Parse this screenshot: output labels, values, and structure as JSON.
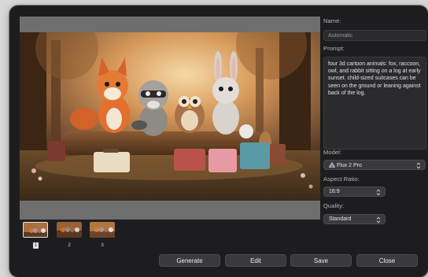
{
  "preview": {
    "alt_icon": "generated-image"
  },
  "fields": {
    "name_label": "Name:",
    "name_value": "Automatic",
    "prompt_label": "Prompt:",
    "prompt_value": "four 3d cartoon animals: fox, raccoon, owl, and rabbit sitting on a log at early sunset. child-sized suitcases can be seen on the ground or leaning against back of the log.",
    "model_label": "Model:",
    "model_value": "Flux 2 Pro",
    "model_icon": "flux-icon",
    "aspect_label": "Aspect Ratio:",
    "aspect_value": "16:9",
    "quality_label": "Quality:",
    "quality_value": "Standard"
  },
  "thumbnails": [
    {
      "label": "1",
      "selected": true
    },
    {
      "label": "2",
      "selected": false
    },
    {
      "label": "3",
      "selected": false
    }
  ],
  "buttons": {
    "generate": "Generate",
    "edit": "Edit",
    "save": "Save",
    "close": "Close"
  }
}
